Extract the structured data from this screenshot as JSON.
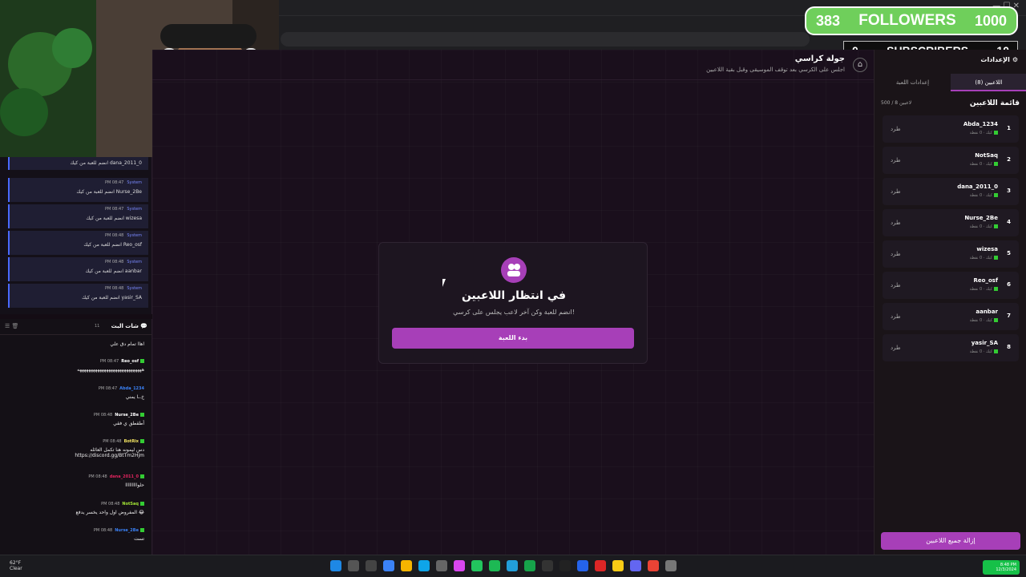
{
  "overlay": {
    "followers": {
      "current": "383",
      "label": "FOLLOWERS",
      "goal": "1000"
    },
    "subscribers": {
      "current": "0",
      "label": "SUBSCRIBERS",
      "goal": "10"
    }
  },
  "app": {
    "round_title": "جولة كراسي",
    "round_subtitle": "اجلس على الكرسي بعد توقف الموسيقى وقبل بقية اللاعبين",
    "home_icon": "home-icon",
    "waiting": {
      "title": "في انتظار اللاعبين",
      "subtitle": "انضم للعبة وكن آخر لاعب يجلس على كرسي!",
      "start_label": "بدء اللعبة"
    }
  },
  "right_panel": {
    "settings_label": "الإعدادات",
    "tabs": [
      {
        "label": "اللاعبين (8)",
        "active": true
      },
      {
        "label": "إعدادات اللعبة",
        "active": false
      }
    ],
    "list_title": "قائمة اللاعبين",
    "count_label": "500 / 8 لاعبين",
    "kick_label": "طرد",
    "score_label": "كيك · 0 نقطة",
    "players": [
      {
        "num": "1",
        "name": "Abda_1234"
      },
      {
        "num": "2",
        "name": "NotSaq"
      },
      {
        "num": "3",
        "name": "dana_2011_0"
      },
      {
        "num": "4",
        "name": "Nurse_2Be"
      },
      {
        "num": "5",
        "name": "wizesa"
      },
      {
        "num": "6",
        "name": "Reo_osf"
      },
      {
        "num": "7",
        "name": "aanbar"
      },
      {
        "num": "8",
        "name": "yasir_SA"
      }
    ],
    "remove_all_label": "إزالة جميع اللاعبين"
  },
  "system_log": {
    "messages": [
      {
        "time": "",
        "user": "",
        "text": "انضم للعبة من كيك dana_2011_0"
      },
      {
        "time": "PM 08:47",
        "user": "System",
        "text": "انضم للعبة من كيك Nurse_2Be"
      },
      {
        "time": "PM 08:47",
        "user": "System",
        "text": "انضم للعبة من كيك wizesa"
      },
      {
        "time": "PM 08:48",
        "user": "System",
        "text": "انضم للعبة من كيك Reo_osf"
      },
      {
        "time": "PM 08:48",
        "user": "System",
        "text": "انضم للعبة من كيك aanbar"
      },
      {
        "time": "PM 08:48",
        "user": "System",
        "text": "انضم للعبة من كيك yasir_SA"
      }
    ]
  },
  "chat": {
    "title": "شات البث",
    "count": "11",
    "messages": [
      {
        "time": "",
        "user": "",
        "color": "#ffffff",
        "text": "اهاا تمام دق علي"
      },
      {
        "time": "PM 08:47",
        "user": "Reo_osf",
        "color": "#ffffff",
        "text": "هههههههههههههههههههههههههههههه"
      },
      {
        "time": "PM 08:47",
        "user": "Abda_1234",
        "color": "#3b82f6",
        "text": "خ.ـا يمني"
      },
      {
        "time": "PM 08:48",
        "user": "Nurse_2Be",
        "color": "#ffffff",
        "text": "أطقطق ي فقي"
      },
      {
        "time": "PM 08:48",
        "user": "BotRix",
        "color": "#f5e663",
        "text": "دس ليمونه هنا تكمل العائله https://discord.gg/BtTm2Hjm"
      },
      {
        "time": "PM 08:48",
        "user": "dana_2011_0",
        "color": "#e0245e",
        "text": "حلوااااااااا"
      },
      {
        "time": "PM 08:48",
        "user": "NotSaq",
        "color": "#a3e635",
        "text": "المفروض اول واحد يخسر يدفع 😂"
      },
      {
        "time": "PM 08:48",
        "user": "Nurse_2Be",
        "color": "#3b82f6",
        "text": "تست"
      }
    ]
  },
  "taskbar": {
    "weather_temp": "62°F",
    "weather_desc": "Clear",
    "time": "8:48 PM",
    "date": "12/3/2024"
  }
}
